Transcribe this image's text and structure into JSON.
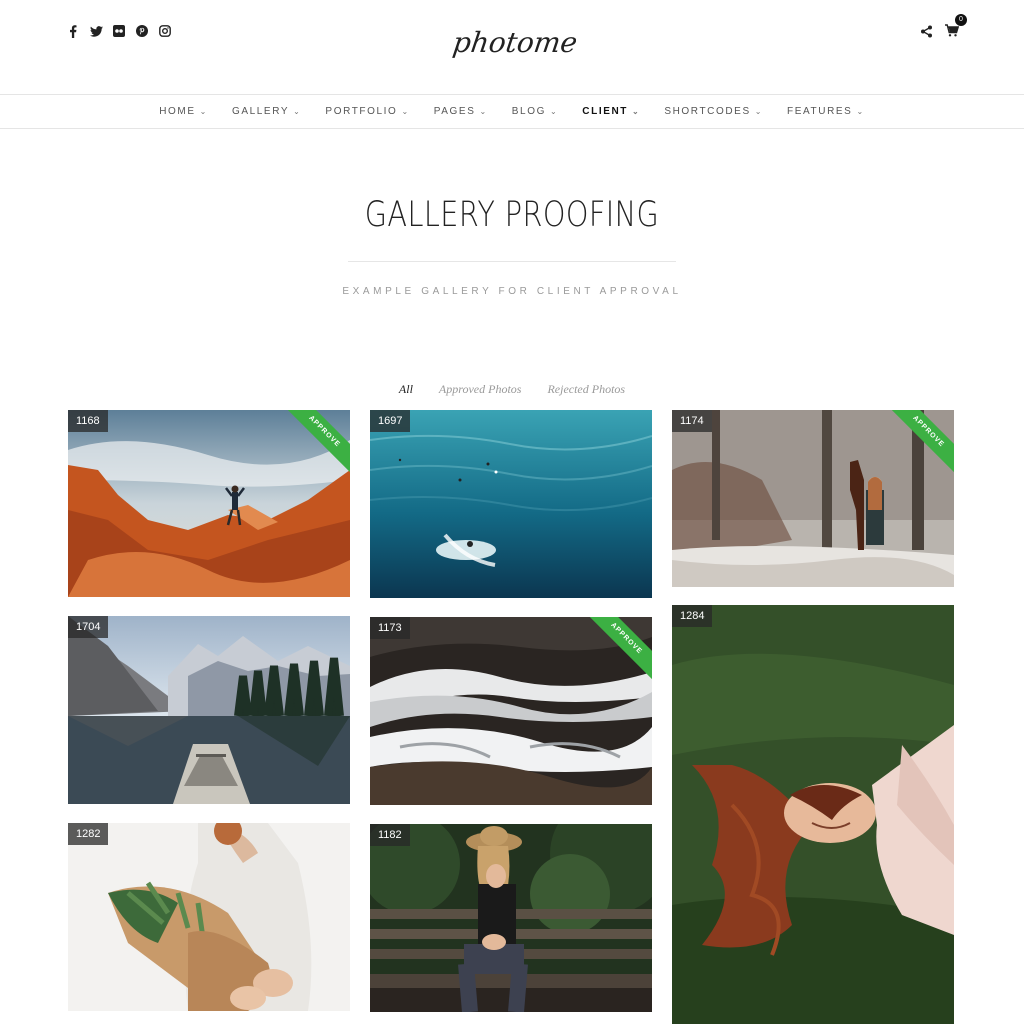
{
  "header": {
    "logo_text": "photome",
    "social_icons": [
      "facebook-icon",
      "twitter-icon",
      "flickr-icon",
      "pinterest-icon",
      "instagram-icon"
    ],
    "cart_count": "0"
  },
  "nav": {
    "items": [
      {
        "label": "HOME"
      },
      {
        "label": "GALLERY"
      },
      {
        "label": "PORTFOLIO"
      },
      {
        "label": "PAGES"
      },
      {
        "label": "BLOG"
      },
      {
        "label": "CLIENT"
      },
      {
        "label": "SHORTCODES"
      },
      {
        "label": "FEATURES"
      }
    ],
    "active": "CLIENT"
  },
  "page": {
    "title": "GALLERY PROOFING",
    "subtitle": "EXAMPLE GALLERY FOR CLIENT APPROVAL"
  },
  "filters": {
    "items": [
      {
        "label": "All"
      },
      {
        "label": "Approved Photos"
      },
      {
        "label": "Rejected Photos"
      }
    ],
    "active": "All"
  },
  "gallery": {
    "approve_label": "APPROVE",
    "tiles": [
      {
        "id": "1168",
        "approved": true
      },
      {
        "id": "1697",
        "approved": false
      },
      {
        "id": "1174",
        "approved": true
      },
      {
        "id": "1704",
        "approved": false
      },
      {
        "id": "1173",
        "approved": true
      },
      {
        "id": "1284",
        "approved": false
      },
      {
        "id": "1282",
        "approved": false
      },
      {
        "id": "1182",
        "approved": false
      }
    ]
  },
  "colors": {
    "approve_green": "#3cb043",
    "badge_bg": "#333333"
  }
}
